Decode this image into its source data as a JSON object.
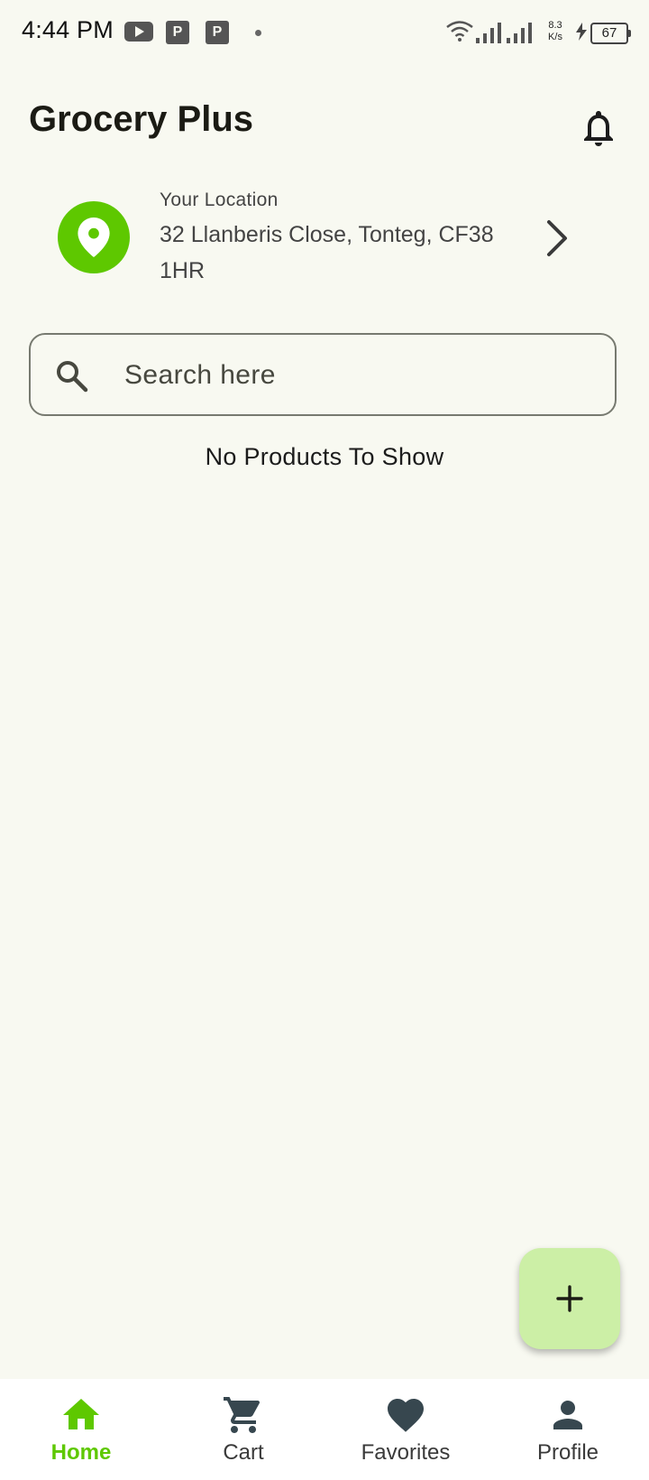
{
  "status_bar": {
    "time": "4:44 PM",
    "speed_value": "8.3",
    "speed_unit": "K/s",
    "battery": "67",
    "icons": [
      "youtube-icon",
      "notification-app-icon",
      "notification-app-icon",
      "dot-icon",
      "wifi-icon",
      "signal-icon",
      "signal-icon",
      "charging-icon",
      "battery-icon"
    ]
  },
  "header": {
    "title": "Grocery Plus",
    "notification_icon": "bell-icon"
  },
  "location": {
    "caption": "Your Location",
    "address": "32 Llanberis Close, Tonteg, CF38 1HR",
    "icon": "location-pin-icon",
    "action_icon": "chevron-right-icon"
  },
  "search": {
    "placeholder": "Search here",
    "value": ""
  },
  "main": {
    "empty_message": "No Products To Show"
  },
  "fab": {
    "icon": "plus-icon"
  },
  "bottom_nav": {
    "items": [
      {
        "label": "Home",
        "icon": "home-icon",
        "active": true
      },
      {
        "label": "Cart",
        "icon": "cart-icon",
        "active": false
      },
      {
        "label": "Favorites",
        "icon": "heart-icon",
        "active": false
      },
      {
        "label": "Profile",
        "icon": "person-icon",
        "active": false
      }
    ]
  },
  "colors": {
    "background": "#f8f9f1",
    "accent": "#5ec800",
    "fab": "#ccefa6",
    "nav_icon": "#37474f"
  }
}
